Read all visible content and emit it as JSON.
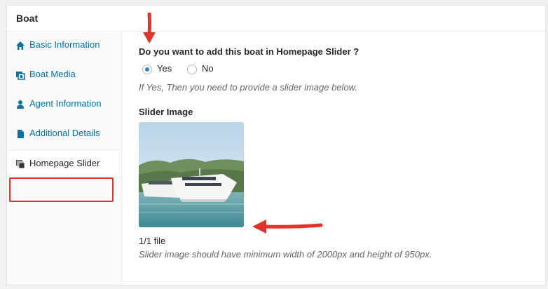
{
  "metabox": {
    "title": "Boat"
  },
  "tabs": [
    {
      "label": "Basic Information",
      "icon": "home-icon",
      "active": false
    },
    {
      "label": "Boat Media",
      "icon": "media-icon",
      "active": false
    },
    {
      "label": "Agent Information",
      "icon": "agent-icon",
      "active": false
    },
    {
      "label": "Additional Details",
      "icon": "details-icon",
      "active": false
    },
    {
      "label": "Homepage Slider",
      "icon": "slider-icon",
      "active": true
    }
  ],
  "slider_section": {
    "question": "Do you want to add this boat in Homepage Slider ?",
    "options": [
      {
        "label": "Yes",
        "checked": true
      },
      {
        "label": "No",
        "checked": false
      }
    ],
    "help_text": "If Yes, Then you need to provide a slider image below.",
    "image_heading": "Slider Image",
    "file_count": "1/1 file",
    "image_note": "Slider image should have minimum width of 2000px and height of 950px."
  },
  "colors": {
    "link": "#0073aa",
    "annotation_red": "#e5332a",
    "radio_checked": "#1e8cbe"
  }
}
